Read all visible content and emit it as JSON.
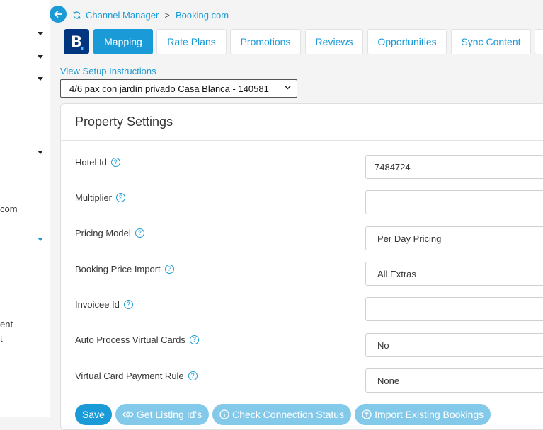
{
  "sidebar": {
    "partial_texts": [
      "com",
      "ent",
      "t"
    ]
  },
  "breadcrumb": {
    "section": "Channel Manager",
    "separator": ">",
    "current": "Booking.com"
  },
  "channel_logo": {
    "letter": "B",
    "dot": "."
  },
  "tabs": [
    {
      "label": "Mapping",
      "active": true
    },
    {
      "label": "Rate Plans",
      "active": false
    },
    {
      "label": "Promotions",
      "active": false
    },
    {
      "label": "Reviews",
      "active": false
    },
    {
      "label": "Opportunities",
      "active": false
    },
    {
      "label": "Sync Content",
      "active": false
    }
  ],
  "setup_link": "View Setup Instructions",
  "listing_select": {
    "value": "4/6 pax con jardín privado Casa Blanca - 140581"
  },
  "panel": {
    "title": "Property Settings",
    "fields": [
      {
        "label": "Hotel Id",
        "value": "7484724"
      },
      {
        "label": "Multiplier",
        "value": ""
      },
      {
        "label": "Pricing Model",
        "value": "Per Day Pricing"
      },
      {
        "label": "Booking Price Import",
        "value": "All Extras"
      },
      {
        "label": "Invoicee Id",
        "value": ""
      },
      {
        "label": "Auto Process Virtual Cards",
        "value": "No"
      },
      {
        "label": "Virtual Card Payment Rule",
        "value": "None"
      }
    ]
  },
  "actions": {
    "save": "Save",
    "get_listing_ids": "Get Listing Id's",
    "check_connection": "Check Connection Status",
    "import_bookings": "Import Existing Bookings"
  },
  "colors": {
    "accent": "#1a9ad6",
    "booking_brand": "#003580",
    "light_button": "#82c9ea"
  }
}
